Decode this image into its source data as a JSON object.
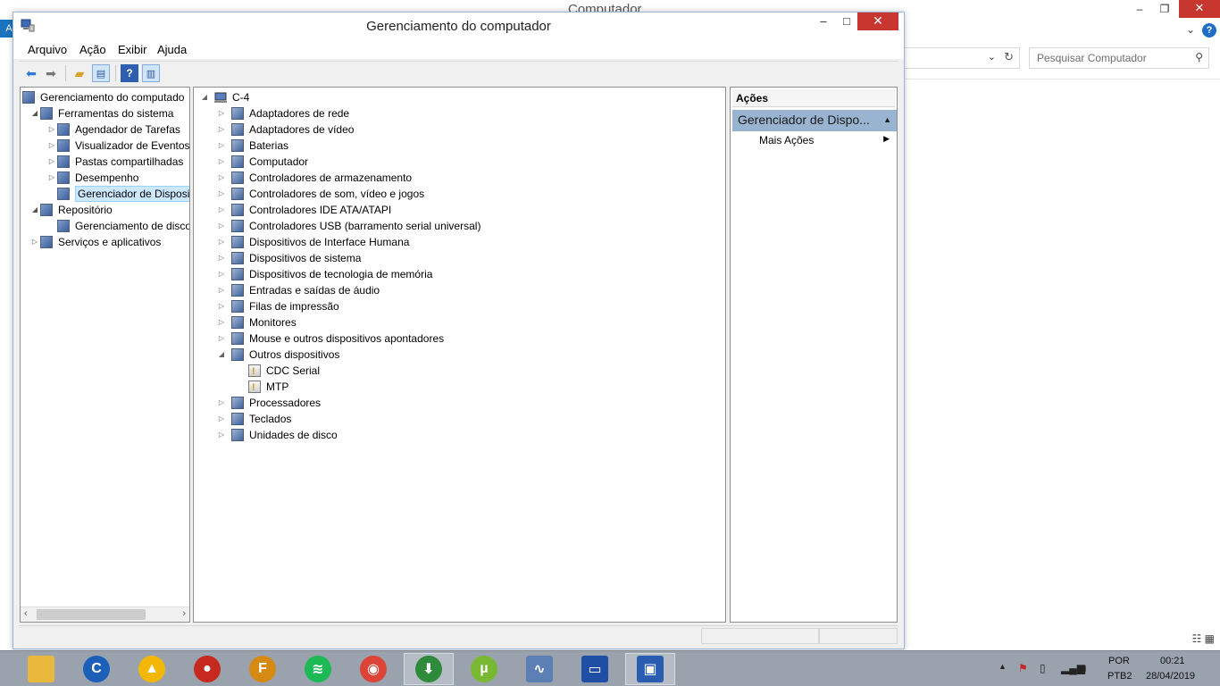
{
  "background_window": {
    "title": "Computador",
    "search_placeholder": "Pesquisar Computador",
    "left_strip_letter": "A"
  },
  "window": {
    "title": "Gerenciamento do computador",
    "minimize": "–",
    "maximize": "□",
    "close": "✕"
  },
  "menu": {
    "items": [
      "Arquivo",
      "Ação",
      "Exibir",
      "Ajuda"
    ]
  },
  "toolbar": {
    "icons": [
      "back-arrow-icon",
      "forward-arrow-icon",
      "up-folder-icon",
      "show-hide-tree-icon",
      "help-icon",
      "show-hide-action-pane-icon"
    ]
  },
  "tree": {
    "items": [
      {
        "label": "Gerenciamento do computado",
        "icon": "computer-management-icon",
        "expander": "",
        "level": 0
      },
      {
        "label": "Ferramentas do sistema",
        "icon": "tools-icon",
        "expander": "◢",
        "level": 1
      },
      {
        "label": "Agendador de Tarefas",
        "icon": "clock-icon",
        "expander": "▷",
        "level": 2
      },
      {
        "label": "Visualizador de Eventos",
        "icon": "event-viewer-icon",
        "expander": "▷",
        "level": 2
      },
      {
        "label": "Pastas compartilhadas",
        "icon": "shared-folder-icon",
        "expander": "▷",
        "level": 2
      },
      {
        "label": "Desempenho",
        "icon": "performance-icon",
        "expander": "▷",
        "level": 2
      },
      {
        "label": "Gerenciador de Disposit",
        "icon": "device-manager-icon",
        "expander": "",
        "level": 2,
        "selected": true
      },
      {
        "label": "Repositório",
        "icon": "storage-icon",
        "expander": "◢",
        "level": 1
      },
      {
        "label": "Gerenciamento de disco",
        "icon": "disk-icon",
        "expander": "",
        "level": 2
      },
      {
        "label": "Serviços e aplicativos",
        "icon": "services-icon",
        "expander": "▷",
        "level": 1
      }
    ]
  },
  "devices": {
    "root": "C-4",
    "items": [
      {
        "label": "Adaptadores de rede",
        "icon": "network-adapter-icon",
        "expander": "▷",
        "child": false
      },
      {
        "label": "Adaptadores de vídeo",
        "icon": "display-adapter-icon",
        "expander": "▷",
        "child": false
      },
      {
        "label": "Baterias",
        "icon": "battery-icon",
        "expander": "▷",
        "child": false
      },
      {
        "label": "Computador",
        "icon": "computer-icon",
        "expander": "▷",
        "child": false
      },
      {
        "label": "Controladores de armazenamento",
        "icon": "storage-controller-icon",
        "expander": "▷",
        "child": false
      },
      {
        "label": "Controladores de som, vídeo e jogos",
        "icon": "speaker-icon",
        "expander": "▷",
        "child": false
      },
      {
        "label": "Controladores IDE ATA/ATAPI",
        "icon": "ide-controller-icon",
        "expander": "▷",
        "child": false
      },
      {
        "label": "Controladores USB (barramento serial universal)",
        "icon": "usb-icon",
        "expander": "▷",
        "child": false
      },
      {
        "label": "Dispositivos de Interface Humana",
        "icon": "hid-icon",
        "expander": "▷",
        "child": false
      },
      {
        "label": "Dispositivos de sistema",
        "icon": "system-device-icon",
        "expander": "▷",
        "child": false
      },
      {
        "label": "Dispositivos de tecnologia de memória",
        "icon": "memory-device-icon",
        "expander": "▷",
        "child": false
      },
      {
        "label": "Entradas e saídas de áudio",
        "icon": "audio-io-icon",
        "expander": "▷",
        "child": false
      },
      {
        "label": "Filas de impressão",
        "icon": "printer-icon",
        "expander": "▷",
        "child": false
      },
      {
        "label": "Monitores",
        "icon": "monitor-icon",
        "expander": "▷",
        "child": false
      },
      {
        "label": "Mouse e outros dispositivos apontadores",
        "icon": "mouse-icon",
        "expander": "▷",
        "child": false
      },
      {
        "label": "Outros dispositivos",
        "icon": "unknown-device-icon",
        "expander": "◢",
        "child": false
      },
      {
        "label": "CDC Serial",
        "icon": "warning-device-icon",
        "expander": "",
        "child": true
      },
      {
        "label": "MTP",
        "icon": "warning-device-icon",
        "expander": "",
        "child": true
      },
      {
        "label": "Processadores",
        "icon": "processor-icon",
        "expander": "▷",
        "child": false
      },
      {
        "label": "Teclados",
        "icon": "keyboard-icon",
        "expander": "▷",
        "child": false
      },
      {
        "label": "Unidades de disco",
        "icon": "disk-drive-icon",
        "expander": "▷",
        "child": false
      }
    ]
  },
  "actions": {
    "header": "Ações",
    "section": "Gerenciador de Dispo...",
    "item": "Mais Ações"
  },
  "taskbar": {
    "apps": [
      {
        "name": "file-explorer-icon",
        "color": "#e8b93c",
        "glyph": ""
      },
      {
        "name": "ccleaner-icon",
        "color": "#1b5fb8",
        "glyph": "C"
      },
      {
        "name": "aimp-icon",
        "color": "#f2b705",
        "glyph": "▲"
      },
      {
        "name": "game-app-icon",
        "color": "#c62a1f",
        "glyph": "●"
      },
      {
        "name": "fl-studio-icon",
        "color": "#d58a14",
        "glyph": "F"
      },
      {
        "name": "spotify-icon",
        "color": "#1db954",
        "glyph": "≋"
      },
      {
        "name": "chrome-icon",
        "color": "#db4437",
        "glyph": "◉"
      },
      {
        "name": "internet-download-manager-icon",
        "color": "#2e8b3c",
        "glyph": "⬇"
      },
      {
        "name": "utorrent-icon",
        "color": "#78b833",
        "glyph": "µ"
      },
      {
        "name": "performance-monitor-icon",
        "color": "#5c7fb5",
        "glyph": "∿"
      },
      {
        "name": "window-app-icon",
        "color": "#1f4fa5",
        "glyph": "▭"
      },
      {
        "name": "computer-management-taskbar-icon",
        "color": "#2a5db0",
        "glyph": "▣"
      }
    ],
    "active_index": [
      7,
      11
    ],
    "language_top": "POR",
    "language_bottom": "PTB2",
    "time": "00:21",
    "date": "28/04/2019"
  }
}
